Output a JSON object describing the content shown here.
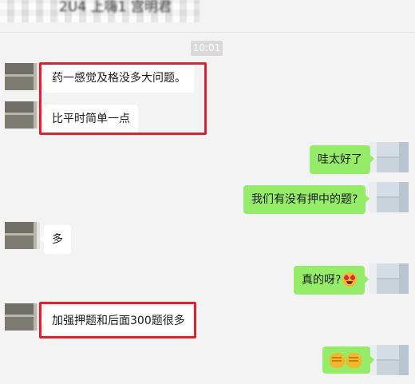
{
  "header": {
    "title": "2U4 上嗨1 宫明君"
  },
  "chat": {
    "timestamp": "10:01",
    "messages": [
      {
        "side": "in",
        "text": "药一感觉及格没多大问题。"
      },
      {
        "side": "in",
        "text": "比平时简单一点"
      },
      {
        "side": "out",
        "text": "哇太好了"
      },
      {
        "side": "out",
        "text": "我们有没有押中的题?"
      },
      {
        "side": "in",
        "text": "多"
      },
      {
        "side": "out",
        "text": "真的呀?",
        "emoji": "star-struck-face-icon"
      },
      {
        "side": "in",
        "text": "加强押题和后面300题很多"
      },
      {
        "side": "out",
        "text": "",
        "emoji": "fist-bump-icon"
      }
    ]
  },
  "colors": {
    "background": "#f3f3f3",
    "incoming_bubble": "#ffffff",
    "outgoing_bubble": "#95ec69",
    "highlight_border": "#e0202e"
  }
}
